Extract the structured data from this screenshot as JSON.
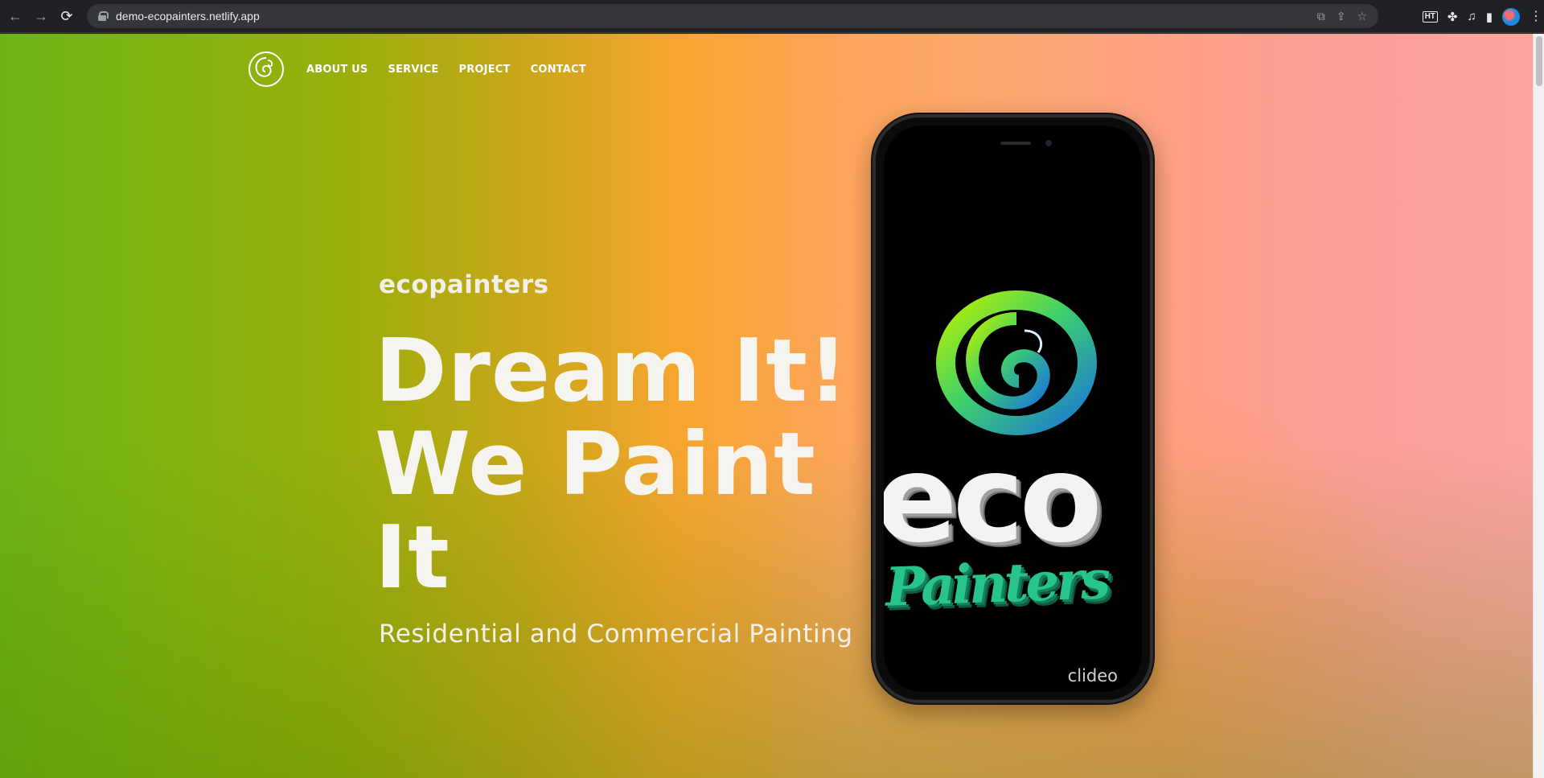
{
  "browser": {
    "url": "demo-ecopainters.netlify.app",
    "extension_badge": "HT"
  },
  "nav": {
    "links": [
      "ABOUT US",
      "SERVICE",
      "PROJECT",
      "CONTACT"
    ]
  },
  "hero": {
    "brand": "ecopainters",
    "headline_line1": "Dream It!",
    "headline_line2": "We Paint",
    "headline_line3": "It",
    "tagline": "Residential and Commercial Painting"
  },
  "phone": {
    "screen_text_eco": "eco",
    "screen_text_painters": "Painters",
    "watermark": "clideo"
  },
  "colors": {
    "gradient_left": "#6ab316",
    "gradient_mid": "#f7a52e",
    "gradient_right": "#fca3a0",
    "painters_green": "#27c48c"
  }
}
